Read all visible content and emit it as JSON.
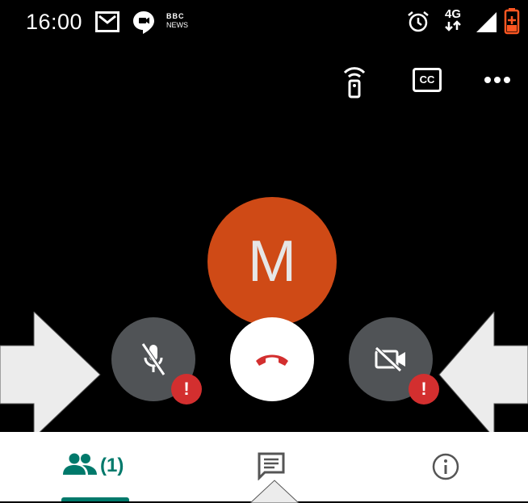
{
  "status_bar": {
    "time": "16:00",
    "left_icons": [
      "gmail-icon",
      "hangouts-icon",
      "bbc-news-icon"
    ],
    "right_icons": [
      "alarm-icon",
      "4g-icon",
      "signal-icon",
      "battery-low-icon"
    ],
    "network": "4G",
    "bbc_label_top": "BBC",
    "bbc_label_bottom": "NEWS"
  },
  "call_toolbar": {
    "icons": [
      "cast-remote-icon",
      "captions-icon",
      "more-options-icon"
    ],
    "captions_label": "CC"
  },
  "participant": {
    "avatar_initial": "M",
    "avatar_color": "#cf4a16"
  },
  "controls": {
    "mic": {
      "state": "muted",
      "alert": "!"
    },
    "end_call": {
      "color": "#d32f2f"
    },
    "camera": {
      "state": "off",
      "alert": "!"
    }
  },
  "bottom_tabs": {
    "people": {
      "icon": "people-icon",
      "count_label": "(1)",
      "active": true
    },
    "chat": {
      "icon": "chat-icon"
    },
    "info": {
      "icon": "info-icon"
    },
    "accent": "#00796b"
  }
}
